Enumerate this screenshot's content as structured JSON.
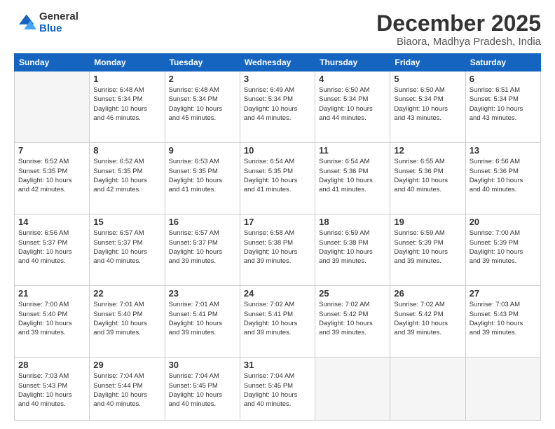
{
  "logo": {
    "general": "General",
    "blue": "Blue"
  },
  "title": "December 2025",
  "subtitle": "Biaora, Madhya Pradesh, India",
  "headers": [
    "Sunday",
    "Monday",
    "Tuesday",
    "Wednesday",
    "Thursday",
    "Friday",
    "Saturday"
  ],
  "weeks": [
    [
      {
        "day": "",
        "info": ""
      },
      {
        "day": "1",
        "info": "Sunrise: 6:48 AM\nSunset: 5:34 PM\nDaylight: 10 hours\nand 46 minutes."
      },
      {
        "day": "2",
        "info": "Sunrise: 6:48 AM\nSunset: 5:34 PM\nDaylight: 10 hours\nand 45 minutes."
      },
      {
        "day": "3",
        "info": "Sunrise: 6:49 AM\nSunset: 5:34 PM\nDaylight: 10 hours\nand 44 minutes."
      },
      {
        "day": "4",
        "info": "Sunrise: 6:50 AM\nSunset: 5:34 PM\nDaylight: 10 hours\nand 44 minutes."
      },
      {
        "day": "5",
        "info": "Sunrise: 6:50 AM\nSunset: 5:34 PM\nDaylight: 10 hours\nand 43 minutes."
      },
      {
        "day": "6",
        "info": "Sunrise: 6:51 AM\nSunset: 5:34 PM\nDaylight: 10 hours\nand 43 minutes."
      }
    ],
    [
      {
        "day": "7",
        "info": "Sunrise: 6:52 AM\nSunset: 5:35 PM\nDaylight: 10 hours\nand 42 minutes."
      },
      {
        "day": "8",
        "info": "Sunrise: 6:52 AM\nSunset: 5:35 PM\nDaylight: 10 hours\nand 42 minutes."
      },
      {
        "day": "9",
        "info": "Sunrise: 6:53 AM\nSunset: 5:35 PM\nDaylight: 10 hours\nand 41 minutes."
      },
      {
        "day": "10",
        "info": "Sunrise: 6:54 AM\nSunset: 5:35 PM\nDaylight: 10 hours\nand 41 minutes."
      },
      {
        "day": "11",
        "info": "Sunrise: 6:54 AM\nSunset: 5:36 PM\nDaylight: 10 hours\nand 41 minutes."
      },
      {
        "day": "12",
        "info": "Sunrise: 6:55 AM\nSunset: 5:36 PM\nDaylight: 10 hours\nand 40 minutes."
      },
      {
        "day": "13",
        "info": "Sunrise: 6:56 AM\nSunset: 5:36 PM\nDaylight: 10 hours\nand 40 minutes."
      }
    ],
    [
      {
        "day": "14",
        "info": "Sunrise: 6:56 AM\nSunset: 5:37 PM\nDaylight: 10 hours\nand 40 minutes."
      },
      {
        "day": "15",
        "info": "Sunrise: 6:57 AM\nSunset: 5:37 PM\nDaylight: 10 hours\nand 40 minutes."
      },
      {
        "day": "16",
        "info": "Sunrise: 6:57 AM\nSunset: 5:37 PM\nDaylight: 10 hours\nand 39 minutes."
      },
      {
        "day": "17",
        "info": "Sunrise: 6:58 AM\nSunset: 5:38 PM\nDaylight: 10 hours\nand 39 minutes."
      },
      {
        "day": "18",
        "info": "Sunrise: 6:59 AM\nSunset: 5:38 PM\nDaylight: 10 hours\nand 39 minutes."
      },
      {
        "day": "19",
        "info": "Sunrise: 6:59 AM\nSunset: 5:39 PM\nDaylight: 10 hours\nand 39 minutes."
      },
      {
        "day": "20",
        "info": "Sunrise: 7:00 AM\nSunset: 5:39 PM\nDaylight: 10 hours\nand 39 minutes."
      }
    ],
    [
      {
        "day": "21",
        "info": "Sunrise: 7:00 AM\nSunset: 5:40 PM\nDaylight: 10 hours\nand 39 minutes."
      },
      {
        "day": "22",
        "info": "Sunrise: 7:01 AM\nSunset: 5:40 PM\nDaylight: 10 hours\nand 39 minutes."
      },
      {
        "day": "23",
        "info": "Sunrise: 7:01 AM\nSunset: 5:41 PM\nDaylight: 10 hours\nand 39 minutes."
      },
      {
        "day": "24",
        "info": "Sunrise: 7:02 AM\nSunset: 5:41 PM\nDaylight: 10 hours\nand 39 minutes."
      },
      {
        "day": "25",
        "info": "Sunrise: 7:02 AM\nSunset: 5:42 PM\nDaylight: 10 hours\nand 39 minutes."
      },
      {
        "day": "26",
        "info": "Sunrise: 7:02 AM\nSunset: 5:42 PM\nDaylight: 10 hours\nand 39 minutes."
      },
      {
        "day": "27",
        "info": "Sunrise: 7:03 AM\nSunset: 5:43 PM\nDaylight: 10 hours\nand 39 minutes."
      }
    ],
    [
      {
        "day": "28",
        "info": "Sunrise: 7:03 AM\nSunset: 5:43 PM\nDaylight: 10 hours\nand 40 minutes."
      },
      {
        "day": "29",
        "info": "Sunrise: 7:04 AM\nSunset: 5:44 PM\nDaylight: 10 hours\nand 40 minutes."
      },
      {
        "day": "30",
        "info": "Sunrise: 7:04 AM\nSunset: 5:45 PM\nDaylight: 10 hours\nand 40 minutes."
      },
      {
        "day": "31",
        "info": "Sunrise: 7:04 AM\nSunset: 5:45 PM\nDaylight: 10 hours\nand 40 minutes."
      },
      {
        "day": "",
        "info": ""
      },
      {
        "day": "",
        "info": ""
      },
      {
        "day": "",
        "info": ""
      }
    ]
  ]
}
